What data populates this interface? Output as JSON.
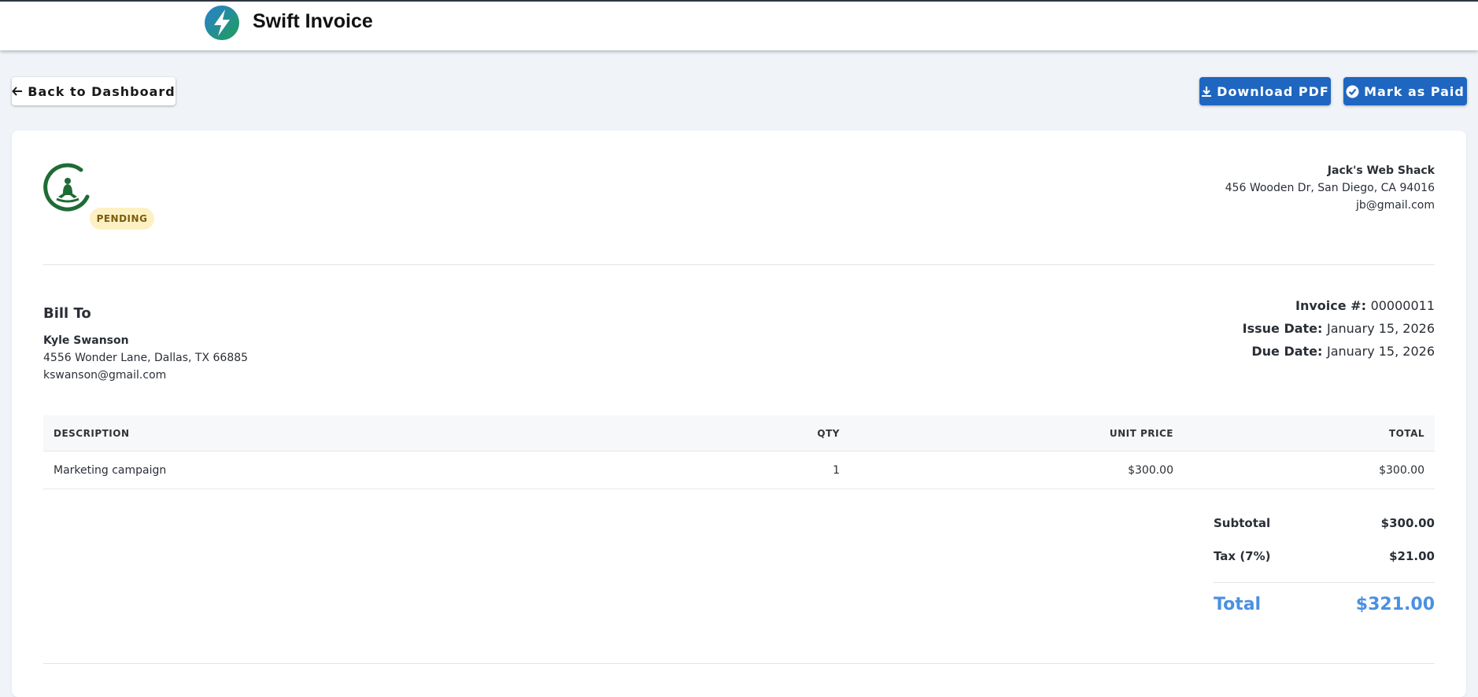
{
  "header": {
    "brand_name": "Swift Invoice",
    "brand_icon": "lightning-bolt-icon"
  },
  "toolbar": {
    "back_label": "Back to Dashboard",
    "download_label": "Download PDF",
    "mark_paid_label": "Mark as Paid"
  },
  "colors": {
    "primary": "#1f66c1",
    "accent": "#4a90e2",
    "badge_bg": "#fdf1c4",
    "badge_text": "#7a5b0a",
    "logo_green": "#1f6b35"
  },
  "invoice": {
    "status": "PENDING",
    "from": {
      "name": "Jack's Web Shack",
      "address": "456 Wooden Dr, San Diego, CA 94016",
      "email": "jb@gmail.com"
    },
    "bill_to": {
      "heading": "Bill To",
      "name": "Kyle Swanson",
      "address": "4556 Wonder Lane, Dallas, TX 66885",
      "email": "kswanson@gmail.com"
    },
    "meta": {
      "number_label": "Invoice #:",
      "number": "00000011",
      "issue_label": "Issue Date:",
      "issue_date": "January 15, 2026",
      "due_label": "Due Date:",
      "due_date": "January 15, 2026"
    },
    "table": {
      "headers": [
        "DESCRIPTION",
        "QTY",
        "UNIT PRICE",
        "TOTAL"
      ],
      "rows": [
        {
          "description": "Marketing campaign",
          "qty": "1",
          "unit_price": "$300.00",
          "total": "$300.00"
        }
      ]
    },
    "totals": {
      "subtotal_label": "Subtotal",
      "subtotal": "$300.00",
      "tax_label": "Tax (7%)",
      "tax": "$21.00",
      "total_label": "Total",
      "total": "$321.00"
    }
  }
}
